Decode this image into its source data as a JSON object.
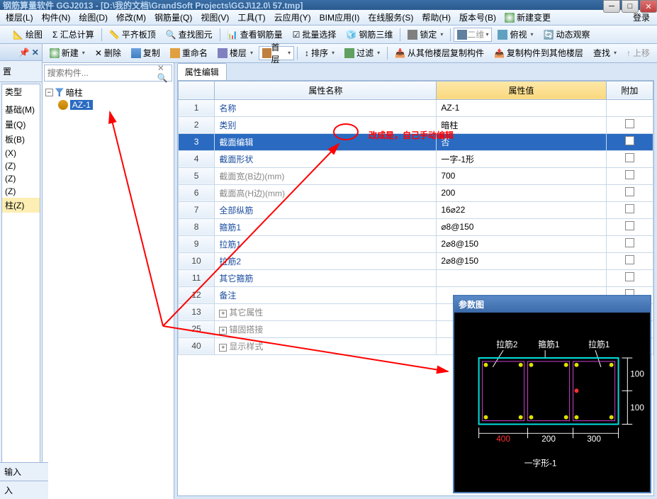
{
  "title": "钢筋算量软件 GGJ2013 - [D:\\我的文档\\GrandSoft Projects\\GGJ\\12.0\\ 57.tmp]",
  "menu": {
    "items": [
      "楼层(L)",
      "构件(N)",
      "绘图(D)",
      "修改(M)",
      "钢筋量(Q)",
      "视图(V)",
      "工具(T)",
      "云应用(Y)",
      "BIM应用(I)",
      "在线服务(S)",
      "帮助(H)",
      "版本号(B)"
    ],
    "newchange": "新建变更",
    "login": "登录"
  },
  "toolbar1": {
    "items": [
      "绘图",
      "Σ 汇总计算",
      "平齐板顶",
      "查找图元",
      "查看钢筋量",
      "批量选择",
      "钢筋三维",
      "锁定",
      "二维",
      "俯视",
      "动态观察"
    ]
  },
  "toolbar2": {
    "new": "新建",
    "del": "删除",
    "copy": "复制",
    "ren": "重命名",
    "floor_lbl": "楼层",
    "floor": "首层",
    "sort": "排序",
    "filter": "过滤",
    "copyfrom": "从其他楼层复制构件",
    "copyto": "复制构件到其他楼层",
    "find": "查找",
    "up": "上移"
  },
  "left": {
    "header": "置",
    "items": [
      "类型",
      "",
      "基础(M)",
      "量(Q)",
      "板(B)",
      "(X)",
      "(Z)",
      "(Z)",
      "(Z)",
      "柱(Z)"
    ]
  },
  "search": {
    "placeholder": "搜索构件..."
  },
  "tree": {
    "root": "暗柱",
    "child": "AZ-1"
  },
  "prop": {
    "tab": "属性编辑",
    "headers": [
      "",
      "属性名称",
      "属性值",
      "附加"
    ],
    "rows": [
      {
        "n": "1",
        "name": "名称",
        "val": "AZ-1",
        "add": false,
        "cls": ""
      },
      {
        "n": "2",
        "name": "类别",
        "val": "暗柱",
        "add": true,
        "cls": ""
      },
      {
        "n": "3",
        "name": "截面编辑",
        "val": "否",
        "add": true,
        "cls": "",
        "sel": true
      },
      {
        "n": "4",
        "name": "截面形状",
        "val": "一字-1形",
        "add": true,
        "cls": ""
      },
      {
        "n": "5",
        "name": "截面宽(B边)(mm)",
        "val": "700",
        "add": true,
        "cls": "gray"
      },
      {
        "n": "6",
        "name": "截面高(H边)(mm)",
        "val": "200",
        "add": true,
        "cls": "gray"
      },
      {
        "n": "7",
        "name": "全部纵筋",
        "val": "16⌀22",
        "add": true,
        "cls": ""
      },
      {
        "n": "8",
        "name": "箍筋1",
        "val": "⌀8@150",
        "add": true,
        "cls": ""
      },
      {
        "n": "9",
        "name": "拉筋1",
        "val": "2⌀8@150",
        "add": true,
        "cls": ""
      },
      {
        "n": "10",
        "name": "拉筋2",
        "val": "2⌀8@150",
        "add": true,
        "cls": ""
      },
      {
        "n": "11",
        "name": "其它箍筋",
        "val": "",
        "add": true,
        "cls": ""
      },
      {
        "n": "12",
        "name": "备注",
        "val": "",
        "add": true,
        "cls": ""
      },
      {
        "n": "13",
        "name": "其它属性",
        "val": "",
        "add": false,
        "cls": "gray",
        "exp": "+"
      },
      {
        "n": "25",
        "name": "锚固搭接",
        "val": "",
        "add": false,
        "cls": "gray",
        "exp": "+"
      },
      {
        "n": "40",
        "name": "显示样式",
        "val": "",
        "add": false,
        "cls": "gray",
        "exp": "+"
      }
    ]
  },
  "annotation": "改成是，自己手动编辑",
  "diagram": {
    "title": "参数图",
    "labels": {
      "l2": "拉筋2",
      "g1": "箍筋1",
      "l1": "拉筋1",
      "shape": "一字形-1",
      "d400": "400",
      "d200": "200",
      "d300": "300",
      "d100a": "100",
      "d100b": "100"
    }
  },
  "bottom": {
    "items": [
      "输入",
      "入"
    ]
  }
}
